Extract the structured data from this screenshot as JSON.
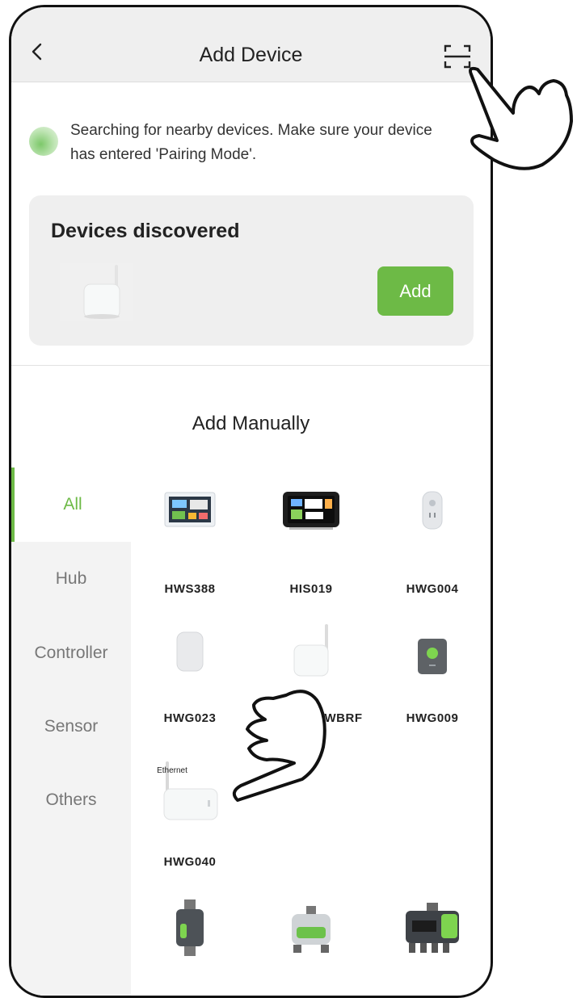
{
  "header": {
    "title": "Add Device"
  },
  "search": {
    "message": "Searching for nearby devices. Make sure your device has entered 'Pairing Mode'."
  },
  "discovered": {
    "title": "Devices discovered",
    "add_label": "Add"
  },
  "manual": {
    "title": "Add Manually",
    "categories": [
      "All",
      "Hub",
      "Controller",
      "Sensor",
      "Others"
    ],
    "selected": "All",
    "devices": [
      {
        "name": "HWS388"
      },
      {
        "name": "HIS019"
      },
      {
        "name": "HWG004"
      },
      {
        "name": "HWG023"
      },
      {
        "name": "WBRF"
      },
      {
        "name": "HWG009"
      },
      {
        "name": "HWG040",
        "label_on_image": "Ethernet"
      }
    ]
  },
  "colors": {
    "accent": "#6dba46",
    "header_bg": "#efefef",
    "card_bg": "#efefef"
  }
}
